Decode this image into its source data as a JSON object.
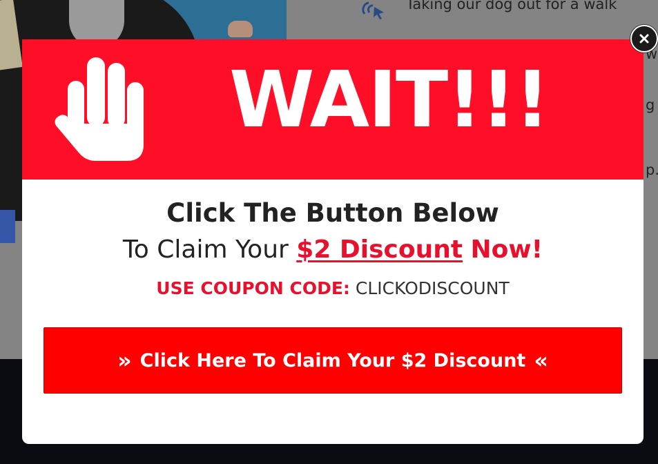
{
  "background": {
    "snippets": [
      "Taking our dog out for a walk",
      "w",
      "g t",
      "p."
    ]
  },
  "modal": {
    "title": "WAIT!!!",
    "headline": "Click The Button Below",
    "subline_prefix": "To Claim Your",
    "subline_discount": "$2 Discount",
    "subline_suffix": "Now!",
    "coupon_label": "USE COUPON CODE:",
    "coupon_code": "CLICKODISCOUNT",
    "button_label": "Click Here To Claim Your $2 Discount",
    "button_left_icon": "»",
    "button_right_icon": "«"
  },
  "icons": {
    "hand": "hand-stop-icon",
    "close": "close-icon",
    "cursor": "cursor-click-icon"
  },
  "colors": {
    "header_red": "#ff0f27",
    "accent_red": "#e8112d",
    "button_red": "#ff0000",
    "text_dark": "#222222",
    "white": "#ffffff"
  }
}
